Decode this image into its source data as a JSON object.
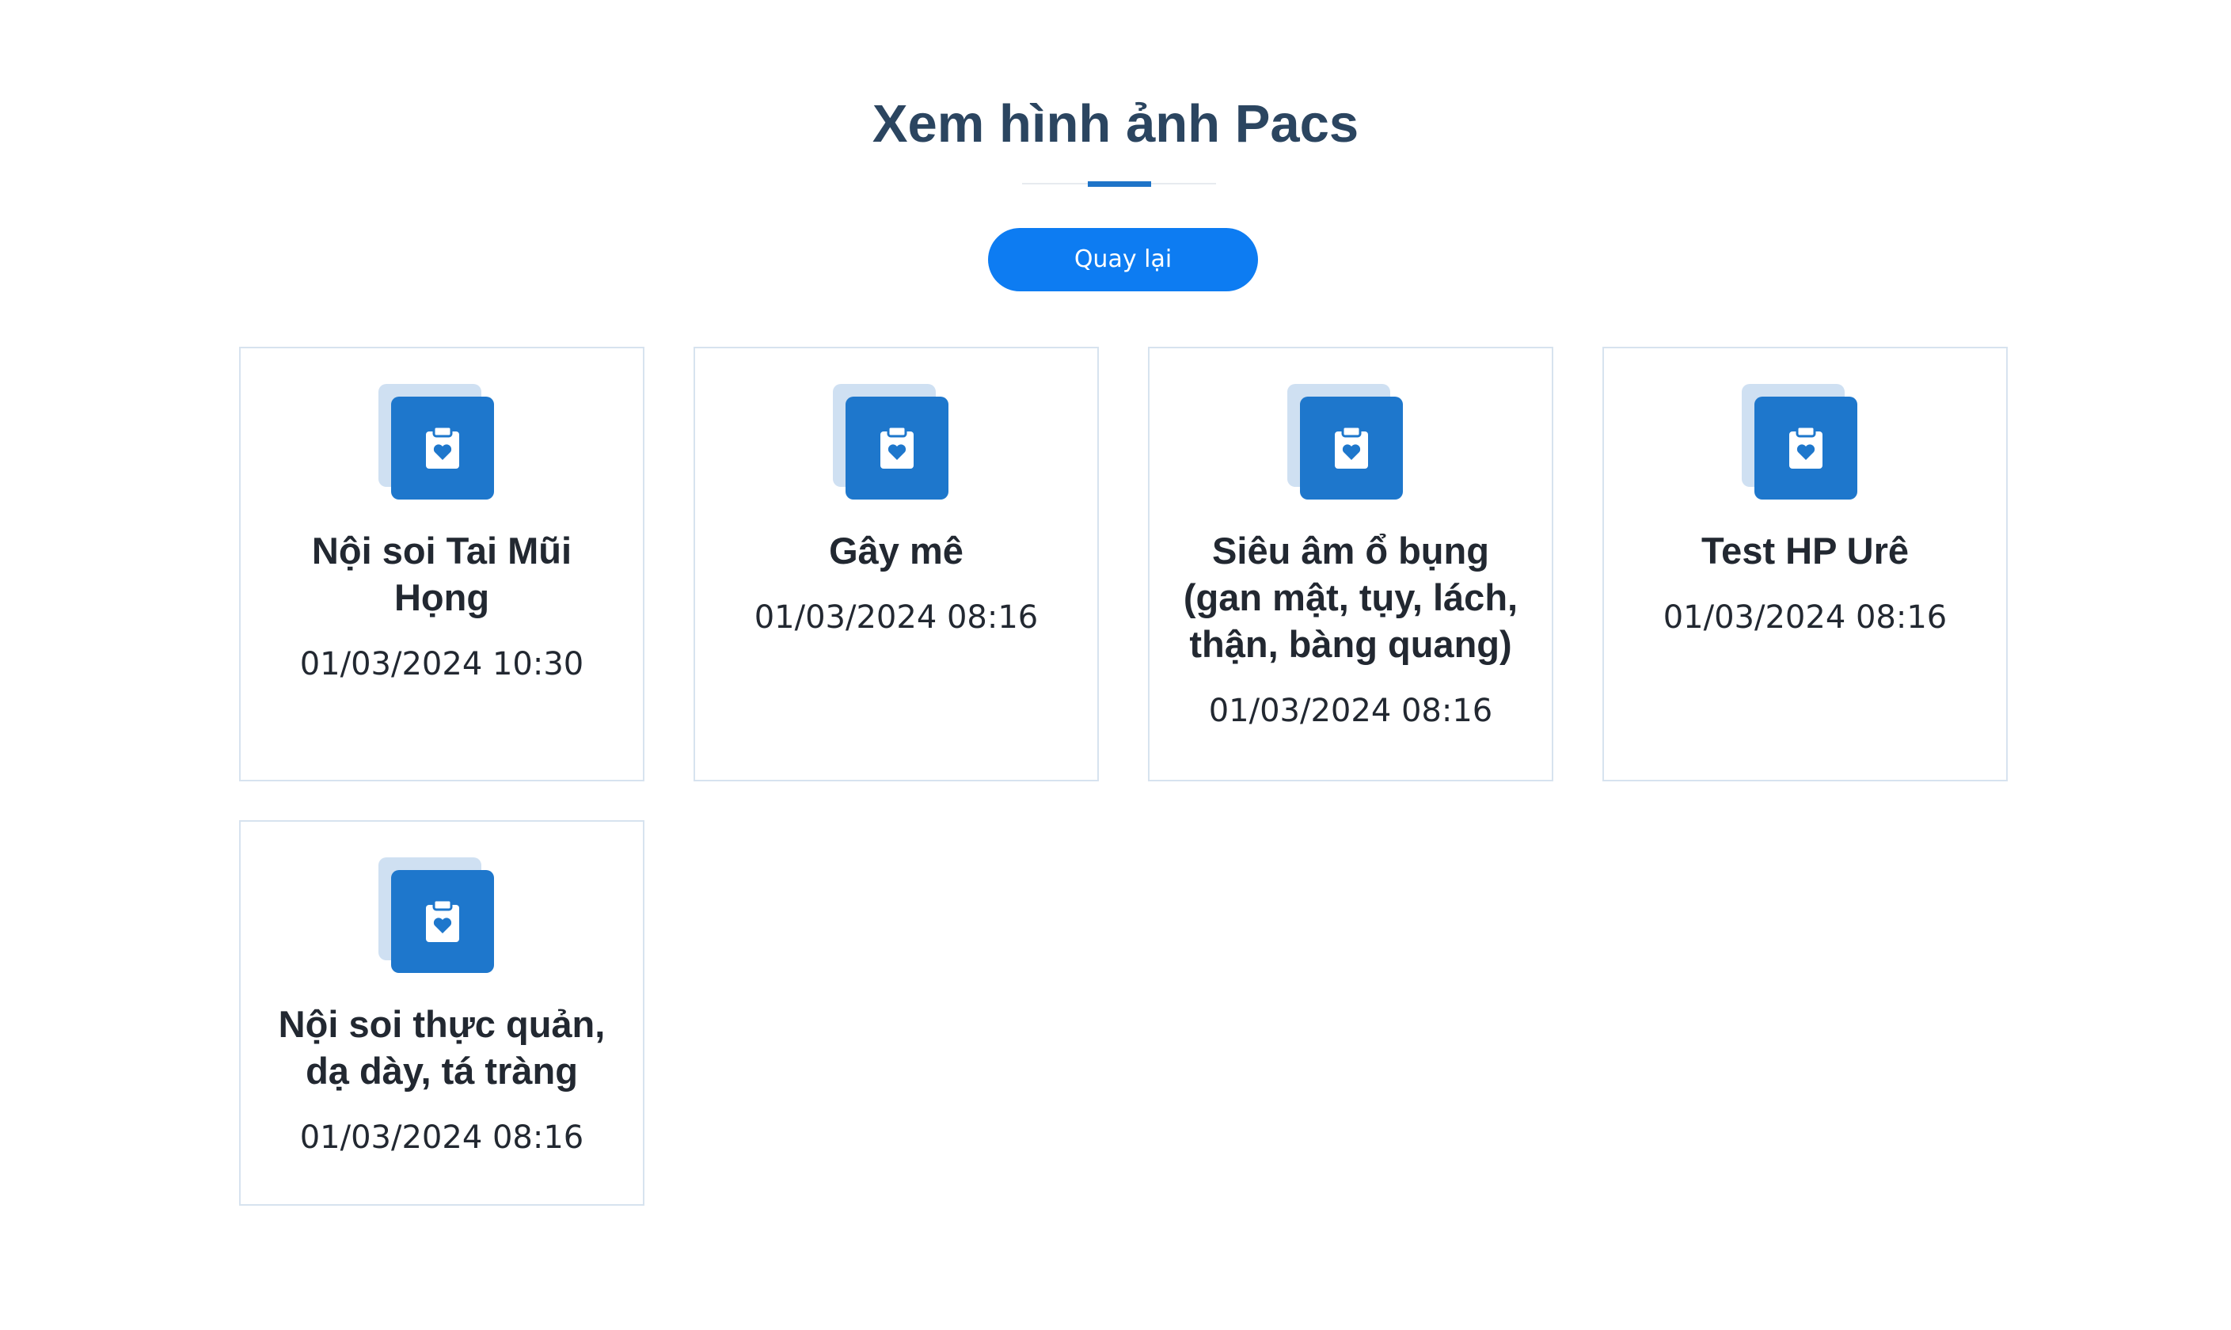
{
  "header": {
    "title": "Xem hình ảnh Pacs"
  },
  "actions": {
    "back_label": "Quay lại"
  },
  "theme": {
    "title_color": "#2b4560",
    "accent": "#1e74c8",
    "button_color": "#0d7cf2",
    "card_border": "#d7e3ef",
    "icon_back": "#cfe0f2",
    "icon_front": "#1e77cc"
  },
  "records": [
    {
      "title": "Nội soi Tai Mũi Họng",
      "datetime": "01/03/2024 10:30",
      "icon": "clipboard-heart-icon"
    },
    {
      "title": "Gây mê",
      "datetime": "01/03/2024 08:16",
      "icon": "clipboard-heart-icon"
    },
    {
      "title": "Siêu âm ổ bụng (gan mật, tụy, lách, thận, bàng quang)",
      "datetime": "01/03/2024 08:16",
      "icon": "clipboard-heart-icon"
    },
    {
      "title": "Test HP Urê",
      "datetime": "01/03/2024 08:16",
      "icon": "clipboard-heart-icon"
    },
    {
      "title": "Nội soi thực quản, dạ dày, tá tràng",
      "datetime": "01/03/2024 08:16",
      "icon": "clipboard-heart-icon"
    }
  ]
}
